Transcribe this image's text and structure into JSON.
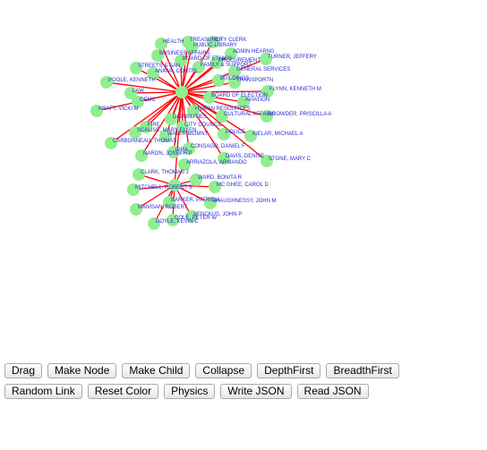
{
  "graph": {
    "node_color": "#90ee90",
    "edge_color": "#ff0000",
    "label_color": "#2b2bd6",
    "labels": [
      "TREASURER",
      "CITY CLERK",
      "HEALTH",
      "PUBLIC LIBRARY",
      "ADMIN HEARNG",
      "BUSINESS AFFAIRS",
      "PROCUREMENT",
      "TURNER,  JEFFERY",
      "BOARD OF ETHICS",
      "FAMILY & SUPPORT",
      "STREETS & SAN",
      "GENERAL SERVICES",
      "ANIMAL CONTRL",
      "BUILDINGS",
      "TRANSPORTN",
      "POOLE,  KENNETH",
      "FLYNN,  KENNETH M",
      "LAW",
      "BOARD OF ELECTION",
      "AVIATION",
      "OEMC",
      "KRAFT,  VICKI M",
      "HUMAN RESOURCES",
      "CULTURAL AFFAIRS",
      "BROWDER,  PRISCILLA A",
      "DISABILITIES",
      "FIRE",
      "CITY COUNCIL",
      "SCALISE,  MARY ELLEN",
      "POLICE",
      "WATER MGMNT",
      "KIELAR,  MICHAEL A",
      "CARBONNEAU,  THOMAS",
      "IPRA",
      "CONSAGO,  DANIEL F",
      "NARON,  JOSEPH P",
      "DAVIS,  DENISE",
      "STONE,  MARY C",
      "ARRIAZOLA,  ARMANDO",
      "CLARK,  THOMAS J",
      "WARD,  BONITA R",
      "MITCHELL,  ROBERT S",
      "MC GHEE,  CAROL D",
      "BARKER,  PATRICIA",
      "SHAUGHNESSY,  JOHN M",
      "MANISAN,  ROBERT",
      "VENCKUS,  JOHN P",
      "DOYLE,  KEVIN C",
      "COLE,  PETER W"
    ]
  },
  "toolbar": {
    "row1": [
      "Drag",
      "Make Node",
      "Make Child",
      "Collapse",
      "DepthFirst",
      "BreadthFirst"
    ],
    "row2": [
      "Random Link",
      "Reset Color",
      "Physics",
      "Write JSON",
      "Read JSON"
    ]
  }
}
